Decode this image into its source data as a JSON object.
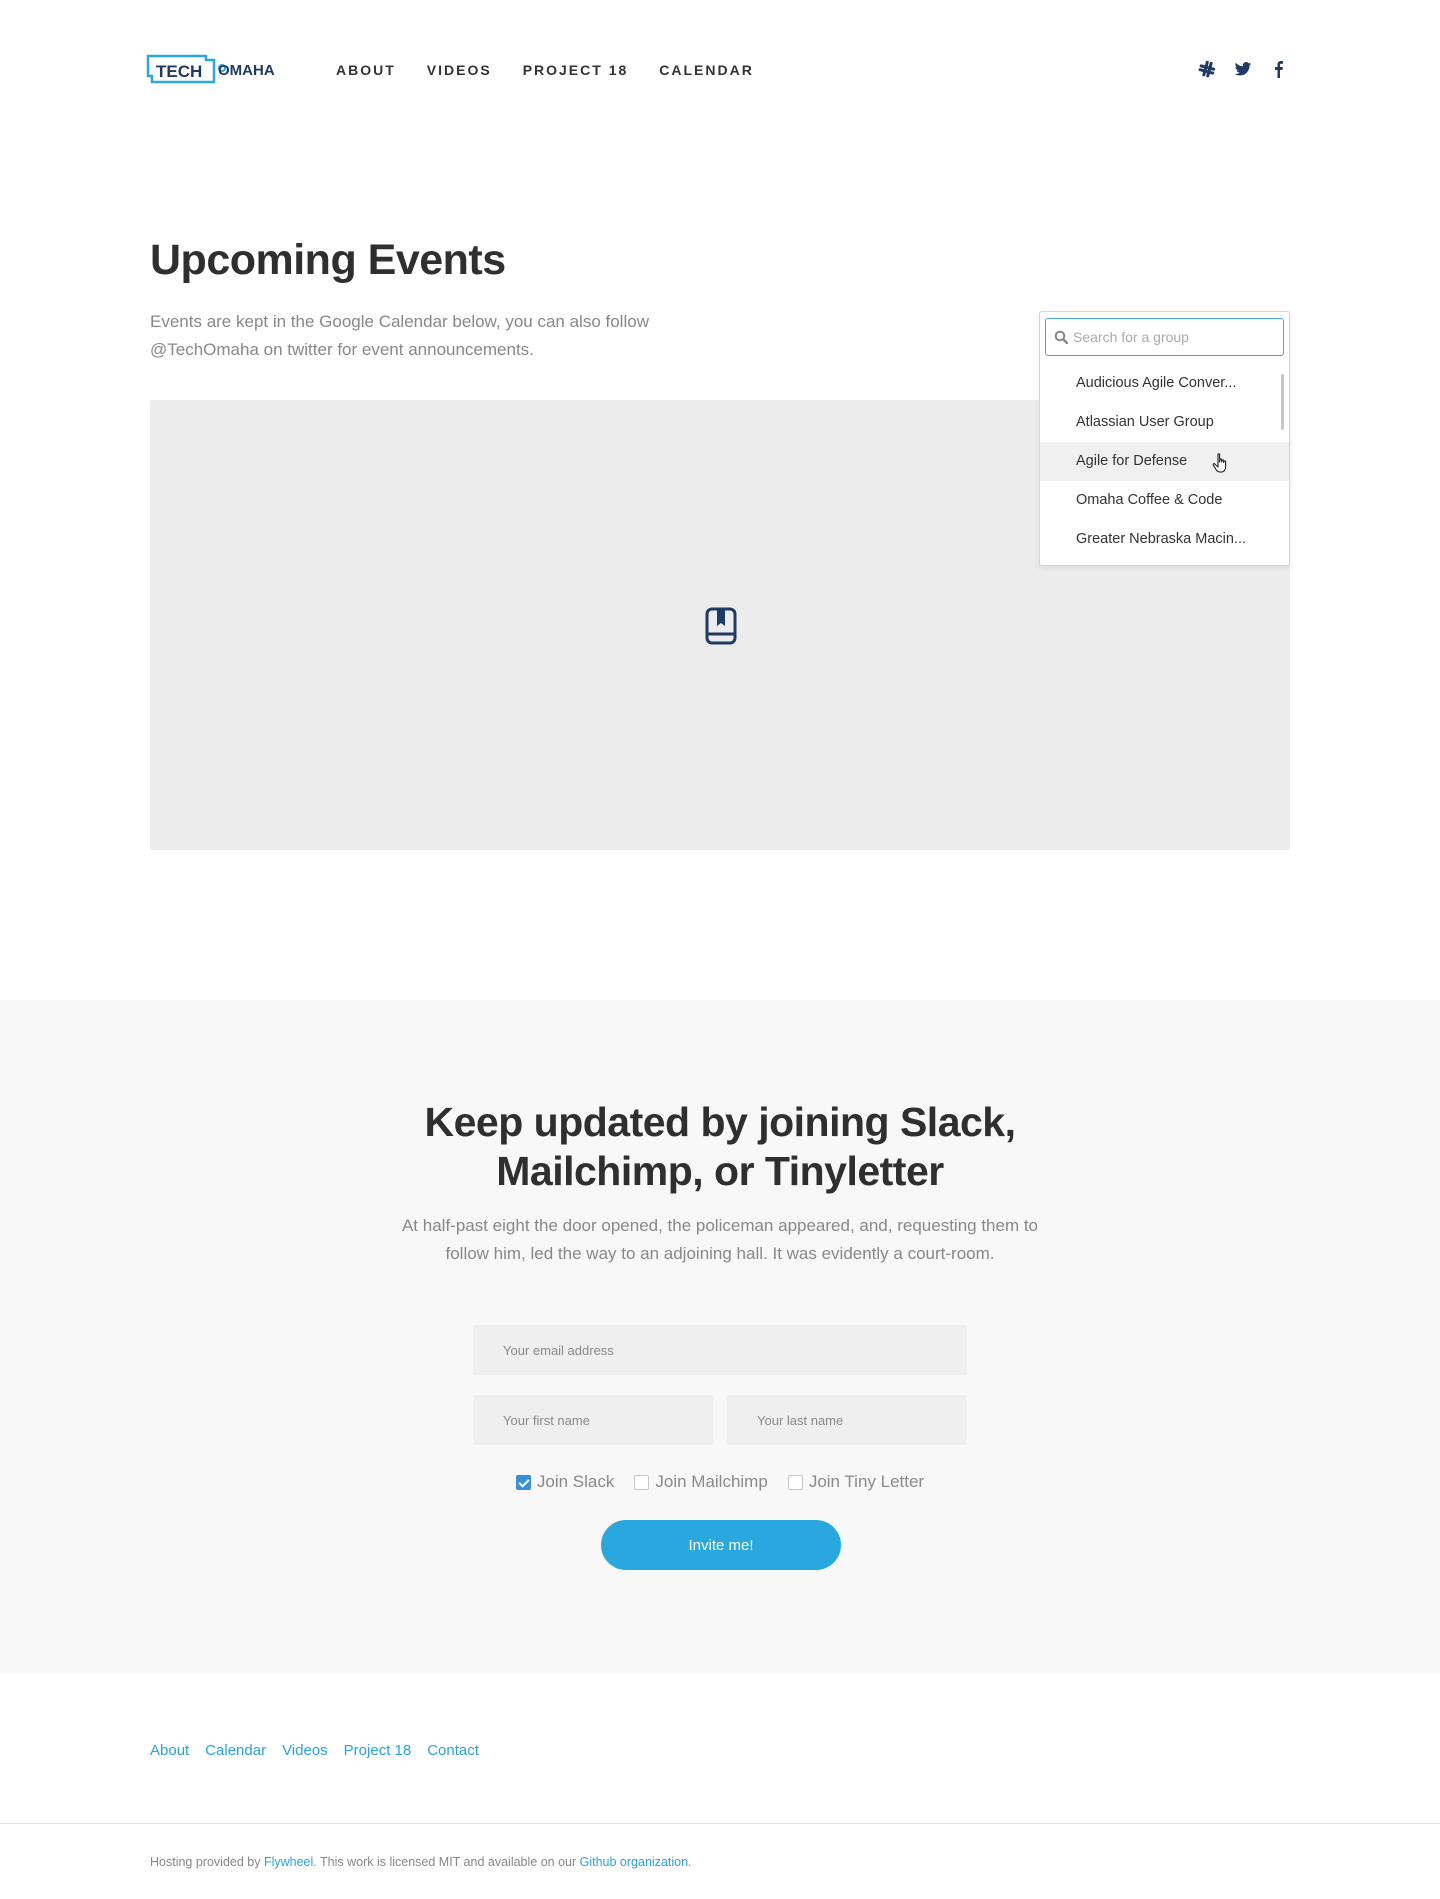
{
  "brand": {
    "logo_text_1": "TECH",
    "logo_text_2": "OMAHA",
    "accent": "#29a8e0",
    "navy": "#1f3b63"
  },
  "nav": {
    "items": [
      "ABOUT",
      "VIDEOS",
      "PROJECT 18",
      "CALENDAR"
    ]
  },
  "social": {
    "icons": [
      "slack-icon",
      "twitter-icon",
      "facebook-icon"
    ]
  },
  "events": {
    "title": "Upcoming Events",
    "description": "Events are kept in the Google Calendar below, you can also follow @TechOmaha on twitter for event announcements."
  },
  "group_search": {
    "placeholder": "Search for a group",
    "items": [
      "Audicious Agile Conver...",
      "Atlassian User Group",
      "Agile for Defense",
      "Omaha Coffee & Code",
      "Greater Nebraska Macin..."
    ],
    "hovered_index": 2
  },
  "subscribe": {
    "title": "Keep updated by joining Slack, Mailchimp, or Tinyletter",
    "description": "At half-past eight the door opened, the policeman appeared, and, requesting them to follow him, led the way to an adjoining hall. It was evidently a court-room.",
    "email_placeholder": "Your email address",
    "first_name_placeholder": "Your first name",
    "last_name_placeholder": "Your last name",
    "options": [
      {
        "label": "Join Slack",
        "checked": true
      },
      {
        "label": "Join Mailchimp",
        "checked": false
      },
      {
        "label": "Join Tiny Letter",
        "checked": false
      }
    ],
    "button_label": "Invite me!"
  },
  "footer": {
    "links": [
      "About",
      "Calendar",
      "Videos",
      "Project 18",
      "Contact"
    ],
    "note_prefix": "Hosting provided by ",
    "note_host": "Flywheel",
    "note_middle": ". This work is licensed MIT and available on our ",
    "note_repo": "Github organization",
    "note_suffix": "."
  }
}
